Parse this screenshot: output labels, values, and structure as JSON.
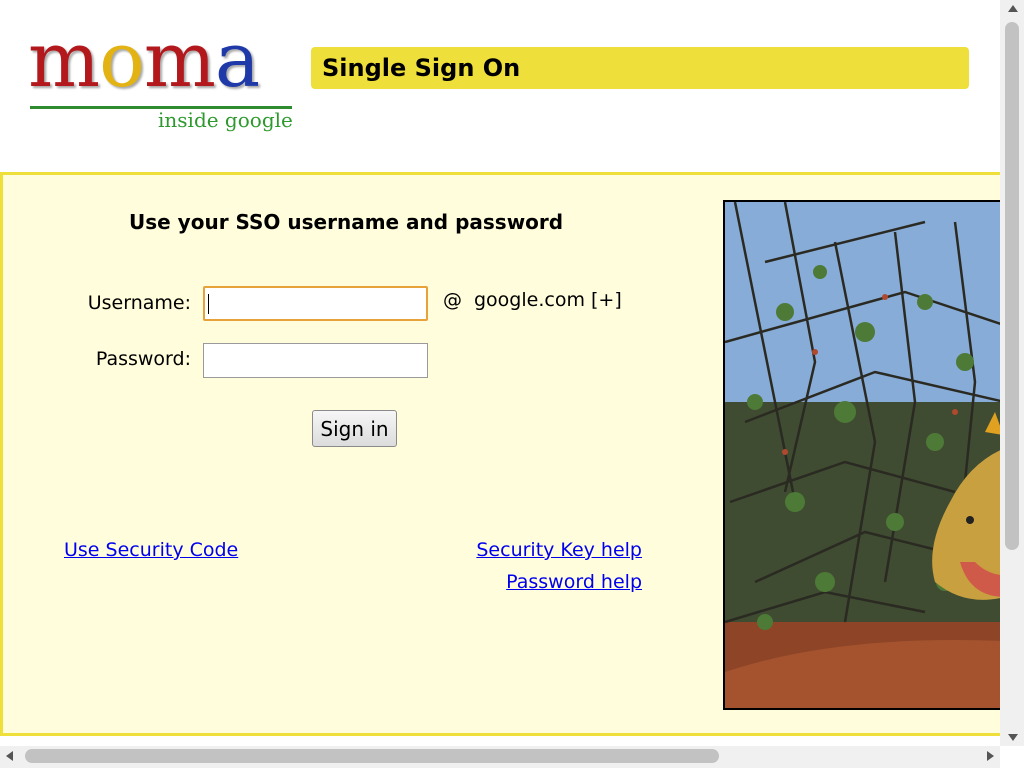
{
  "header": {
    "logo": {
      "letters": [
        "m",
        "o",
        "m",
        "a"
      ],
      "letter_colors": [
        "#b3191c",
        "#e2b313",
        "#b3191c",
        "#1f3aa8"
      ],
      "subtitle": "inside google",
      "subtitle_color": "#2e9a2e"
    },
    "title": "Single Sign On",
    "title_color": "#eedf3a"
  },
  "login": {
    "heading": "Use your SSO username and password",
    "username_label": "Username:",
    "username_value": "",
    "password_label": "Password:",
    "password_value": "",
    "at_sign": "@",
    "domain": "google.com [+]",
    "signin_label": "Sign in",
    "field_focus_color": "#e8a23a"
  },
  "links": {
    "security_code": "Use Security Code",
    "security_key_help": "Security Key help",
    "password_help": "Password help"
  },
  "colors": {
    "panel_background": "#fffddb",
    "panel_border": "#eedf3a",
    "link": "#0000ee"
  },
  "icons": {
    "photo": "iguana-photo-icon",
    "scroll_up": "arrow-up-icon",
    "scroll_down": "arrow-down-icon",
    "scroll_left": "arrow-left-icon",
    "scroll_right": "arrow-right-icon"
  }
}
